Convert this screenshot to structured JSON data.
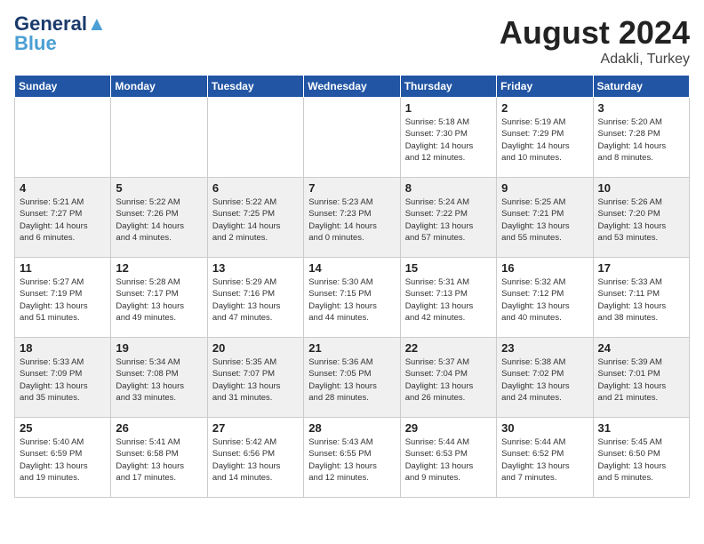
{
  "logo": {
    "line1": "General",
    "line2": "Blue"
  },
  "header": {
    "month": "August 2024",
    "location": "Adakli, Turkey"
  },
  "days_of_week": [
    "Sunday",
    "Monday",
    "Tuesday",
    "Wednesday",
    "Thursday",
    "Friday",
    "Saturday"
  ],
  "weeks": [
    [
      {
        "day": "",
        "info": ""
      },
      {
        "day": "",
        "info": ""
      },
      {
        "day": "",
        "info": ""
      },
      {
        "day": "",
        "info": ""
      },
      {
        "day": "1",
        "info": "Sunrise: 5:18 AM\nSunset: 7:30 PM\nDaylight: 14 hours\nand 12 minutes."
      },
      {
        "day": "2",
        "info": "Sunrise: 5:19 AM\nSunset: 7:29 PM\nDaylight: 14 hours\nand 10 minutes."
      },
      {
        "day": "3",
        "info": "Sunrise: 5:20 AM\nSunset: 7:28 PM\nDaylight: 14 hours\nand 8 minutes."
      }
    ],
    [
      {
        "day": "4",
        "info": "Sunrise: 5:21 AM\nSunset: 7:27 PM\nDaylight: 14 hours\nand 6 minutes."
      },
      {
        "day": "5",
        "info": "Sunrise: 5:22 AM\nSunset: 7:26 PM\nDaylight: 14 hours\nand 4 minutes."
      },
      {
        "day": "6",
        "info": "Sunrise: 5:22 AM\nSunset: 7:25 PM\nDaylight: 14 hours\nand 2 minutes."
      },
      {
        "day": "7",
        "info": "Sunrise: 5:23 AM\nSunset: 7:23 PM\nDaylight: 14 hours\nand 0 minutes."
      },
      {
        "day": "8",
        "info": "Sunrise: 5:24 AM\nSunset: 7:22 PM\nDaylight: 13 hours\nand 57 minutes."
      },
      {
        "day": "9",
        "info": "Sunrise: 5:25 AM\nSunset: 7:21 PM\nDaylight: 13 hours\nand 55 minutes."
      },
      {
        "day": "10",
        "info": "Sunrise: 5:26 AM\nSunset: 7:20 PM\nDaylight: 13 hours\nand 53 minutes."
      }
    ],
    [
      {
        "day": "11",
        "info": "Sunrise: 5:27 AM\nSunset: 7:19 PM\nDaylight: 13 hours\nand 51 minutes."
      },
      {
        "day": "12",
        "info": "Sunrise: 5:28 AM\nSunset: 7:17 PM\nDaylight: 13 hours\nand 49 minutes."
      },
      {
        "day": "13",
        "info": "Sunrise: 5:29 AM\nSunset: 7:16 PM\nDaylight: 13 hours\nand 47 minutes."
      },
      {
        "day": "14",
        "info": "Sunrise: 5:30 AM\nSunset: 7:15 PM\nDaylight: 13 hours\nand 44 minutes."
      },
      {
        "day": "15",
        "info": "Sunrise: 5:31 AM\nSunset: 7:13 PM\nDaylight: 13 hours\nand 42 minutes."
      },
      {
        "day": "16",
        "info": "Sunrise: 5:32 AM\nSunset: 7:12 PM\nDaylight: 13 hours\nand 40 minutes."
      },
      {
        "day": "17",
        "info": "Sunrise: 5:33 AM\nSunset: 7:11 PM\nDaylight: 13 hours\nand 38 minutes."
      }
    ],
    [
      {
        "day": "18",
        "info": "Sunrise: 5:33 AM\nSunset: 7:09 PM\nDaylight: 13 hours\nand 35 minutes."
      },
      {
        "day": "19",
        "info": "Sunrise: 5:34 AM\nSunset: 7:08 PM\nDaylight: 13 hours\nand 33 minutes."
      },
      {
        "day": "20",
        "info": "Sunrise: 5:35 AM\nSunset: 7:07 PM\nDaylight: 13 hours\nand 31 minutes."
      },
      {
        "day": "21",
        "info": "Sunrise: 5:36 AM\nSunset: 7:05 PM\nDaylight: 13 hours\nand 28 minutes."
      },
      {
        "day": "22",
        "info": "Sunrise: 5:37 AM\nSunset: 7:04 PM\nDaylight: 13 hours\nand 26 minutes."
      },
      {
        "day": "23",
        "info": "Sunrise: 5:38 AM\nSunset: 7:02 PM\nDaylight: 13 hours\nand 24 minutes."
      },
      {
        "day": "24",
        "info": "Sunrise: 5:39 AM\nSunset: 7:01 PM\nDaylight: 13 hours\nand 21 minutes."
      }
    ],
    [
      {
        "day": "25",
        "info": "Sunrise: 5:40 AM\nSunset: 6:59 PM\nDaylight: 13 hours\nand 19 minutes."
      },
      {
        "day": "26",
        "info": "Sunrise: 5:41 AM\nSunset: 6:58 PM\nDaylight: 13 hours\nand 17 minutes."
      },
      {
        "day": "27",
        "info": "Sunrise: 5:42 AM\nSunset: 6:56 PM\nDaylight: 13 hours\nand 14 minutes."
      },
      {
        "day": "28",
        "info": "Sunrise: 5:43 AM\nSunset: 6:55 PM\nDaylight: 13 hours\nand 12 minutes."
      },
      {
        "day": "29",
        "info": "Sunrise: 5:44 AM\nSunset: 6:53 PM\nDaylight: 13 hours\nand 9 minutes."
      },
      {
        "day": "30",
        "info": "Sunrise: 5:44 AM\nSunset: 6:52 PM\nDaylight: 13 hours\nand 7 minutes."
      },
      {
        "day": "31",
        "info": "Sunrise: 5:45 AM\nSunset: 6:50 PM\nDaylight: 13 hours\nand 5 minutes."
      }
    ]
  ]
}
